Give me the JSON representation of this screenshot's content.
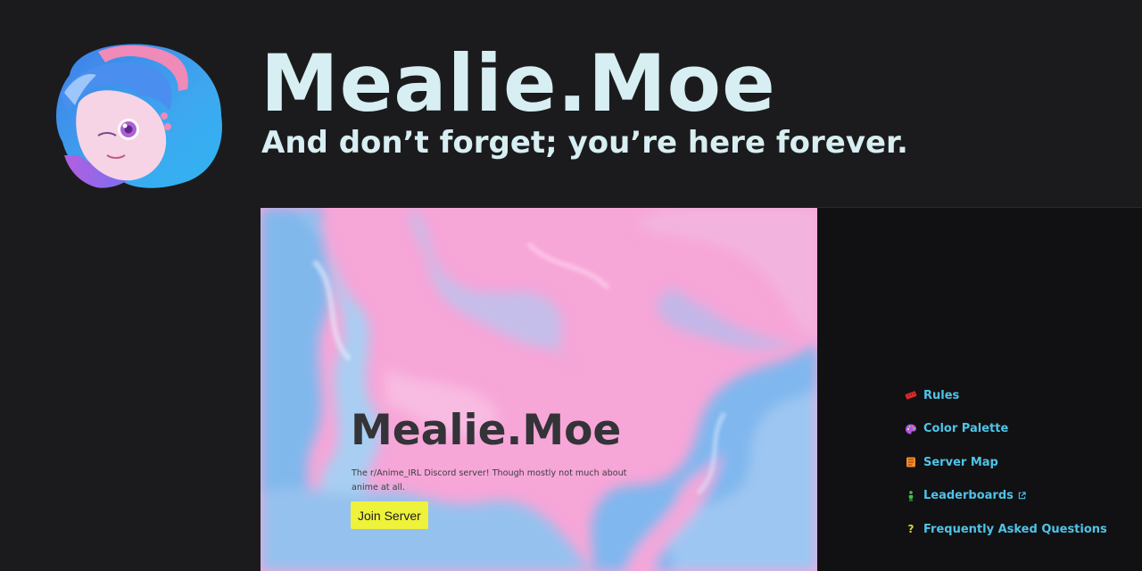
{
  "header": {
    "title": "Mealie.Moe",
    "tagline": "And don’t forget; you’re here forever."
  },
  "mascot": {
    "icon": "mascot-avatar"
  },
  "hero": {
    "title": "Mealie.Moe",
    "description": "The r/Anime_IRL Discord server! Though mostly not much about anime at all.",
    "button_label": "Join Server",
    "button_color": "#eef23a"
  },
  "nav": {
    "items": [
      {
        "label": "Rules",
        "icon": "ruler-icon",
        "icon_color": "#d92a2a"
      },
      {
        "label": "Color Palette",
        "icon": "palette-icon",
        "icon_color": "#b455e0"
      },
      {
        "label": "Server Map",
        "icon": "map-icon",
        "icon_color": "#f08a2a"
      },
      {
        "label": "Leaderboards",
        "icon": "person-icon",
        "icon_color": "#3ec24a",
        "external": true
      },
      {
        "label": "Frequently Asked Questions",
        "icon": "question-icon",
        "icon_color": "#d9d43a"
      }
    ],
    "link_color": "#4fc3e8"
  },
  "colors": {
    "background": "#1b1b1d",
    "title": "#d7eef2",
    "panel": "#111113"
  }
}
